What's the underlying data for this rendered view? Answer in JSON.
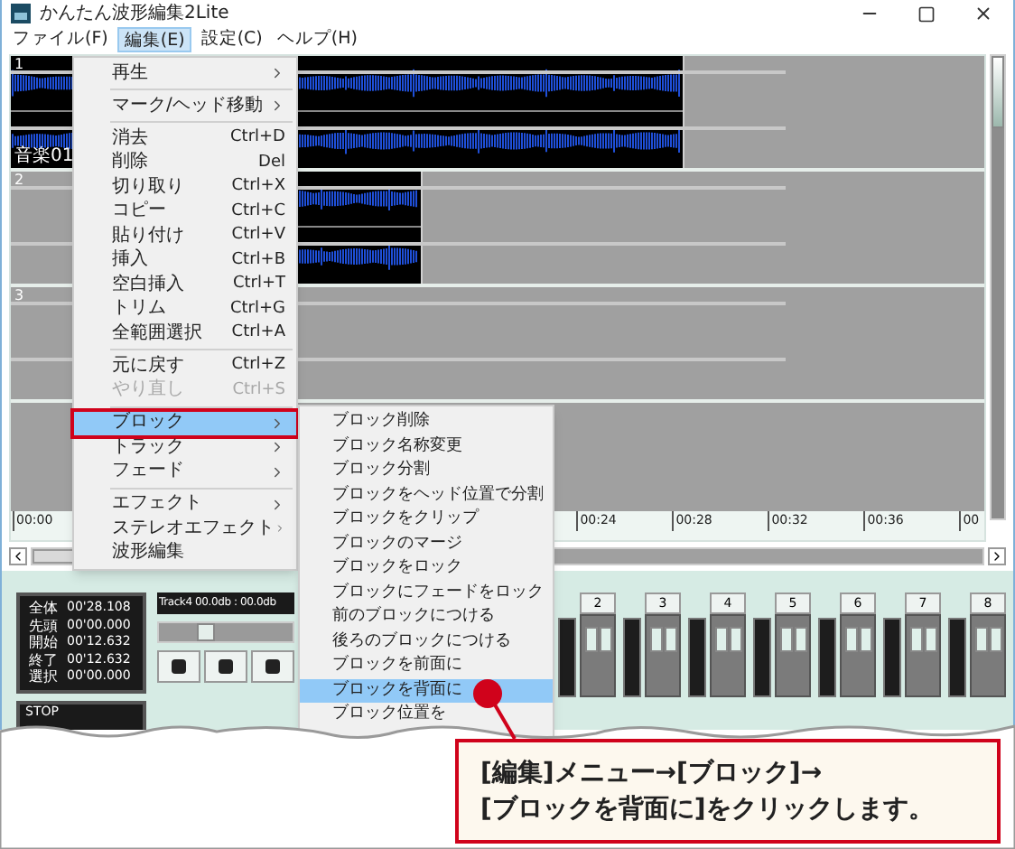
{
  "window": {
    "title": "かんたん波形編集2Lite"
  },
  "menu_bar": [
    {
      "label": "ファイル(F)",
      "selected": false
    },
    {
      "label": "編集(E)",
      "selected": true
    },
    {
      "label": "設定(C)",
      "selected": false
    },
    {
      "label": "ヘルプ(H)",
      "selected": false
    }
  ],
  "tracks": [
    {
      "label": "1",
      "name": "音楽01",
      "kind": "audio"
    },
    {
      "label": "2",
      "kind": "audio"
    },
    {
      "label": "3",
      "kind": "empty"
    }
  ],
  "timeline": {
    "start": "00:00",
    "ticks": [
      "00:24",
      "00:28",
      "00:32",
      "00:36",
      "00"
    ]
  },
  "time_info": [
    {
      "label": "全体",
      "value": "00'28.108"
    },
    {
      "label": "先頭",
      "value": "00'00.000"
    },
    {
      "label": "開始",
      "value": "00'12.632"
    },
    {
      "label": "終了",
      "value": "00'12.632"
    },
    {
      "label": "選択",
      "value": "00'00.000"
    }
  ],
  "transport": {
    "status": "STOP",
    "track_readout": "Track4 00.0db : 00.0db",
    "level": 0.35
  },
  "mixer_channels": [
    "2",
    "3",
    "4",
    "5",
    "6",
    "7",
    "8"
  ],
  "edit_menu": [
    {
      "kind": "item",
      "label": "再生",
      "submenu": true,
      "selected": false,
      "disabled": false
    },
    {
      "kind": "separator"
    },
    {
      "kind": "item",
      "label": "マーク/ヘッド移動",
      "submenu": true,
      "selected": false,
      "disabled": false
    },
    {
      "kind": "separator"
    },
    {
      "kind": "item",
      "label": "消去",
      "shortcut": "Ctrl+D",
      "submenu": false,
      "selected": false,
      "disabled": false
    },
    {
      "kind": "item",
      "label": "削除",
      "shortcut": "Del",
      "submenu": false,
      "selected": false,
      "disabled": false
    },
    {
      "kind": "item",
      "label": "切り取り",
      "shortcut": "Ctrl+X",
      "submenu": false,
      "selected": false,
      "disabled": false
    },
    {
      "kind": "item",
      "label": "コピー",
      "shortcut": "Ctrl+C",
      "submenu": false,
      "selected": false,
      "disabled": false
    },
    {
      "kind": "item",
      "label": "貼り付け",
      "shortcut": "Ctrl+V",
      "submenu": false,
      "selected": false,
      "disabled": false
    },
    {
      "kind": "item",
      "label": "挿入",
      "shortcut": "Ctrl+B",
      "submenu": false,
      "selected": false,
      "disabled": false
    },
    {
      "kind": "item",
      "label": "空白挿入",
      "shortcut": "Ctrl+T",
      "submenu": false,
      "selected": false,
      "disabled": false
    },
    {
      "kind": "item",
      "label": "トリム",
      "shortcut": "Ctrl+G",
      "submenu": false,
      "selected": false,
      "disabled": false
    },
    {
      "kind": "item",
      "label": "全範囲選択",
      "shortcut": "Ctrl+A",
      "submenu": false,
      "selected": false,
      "disabled": false
    },
    {
      "kind": "separator"
    },
    {
      "kind": "item",
      "label": "元に戻す",
      "shortcut": "Ctrl+Z",
      "submenu": false,
      "selected": false,
      "disabled": false
    },
    {
      "kind": "item",
      "label": "やり直し",
      "shortcut": "Ctrl+S",
      "submenu": false,
      "selected": false,
      "disabled": true
    },
    {
      "kind": "separator"
    },
    {
      "kind": "item",
      "label": "ブロック",
      "submenu": true,
      "selected": true,
      "disabled": false
    },
    {
      "kind": "item",
      "label": "トラック",
      "submenu": true,
      "selected": false,
      "disabled": false
    },
    {
      "kind": "item",
      "label": "フェード",
      "submenu": true,
      "selected": false,
      "disabled": false
    },
    {
      "kind": "separator"
    },
    {
      "kind": "item",
      "label": "エフェクト",
      "submenu": true,
      "selected": false,
      "disabled": false
    },
    {
      "kind": "item",
      "label": "ステレオエフェクト",
      "submenu": true,
      "selected": false,
      "disabled": false
    },
    {
      "kind": "item",
      "label": "波形編集",
      "submenu": false,
      "selected": false,
      "disabled": false
    }
  ],
  "block_submenu": [
    {
      "label": "ブロック削除",
      "selected": false
    },
    {
      "label": "ブロック名称変更",
      "selected": false
    },
    {
      "label": "ブロック分割",
      "selected": false
    },
    {
      "label": "ブロックをヘッド位置で分割",
      "selected": false
    },
    {
      "label": "ブロックをクリップ",
      "selected": false
    },
    {
      "label": "ブロックのマージ",
      "selected": false
    },
    {
      "label": "ブロックをロック",
      "selected": false
    },
    {
      "label": "ブロックにフェードをロック",
      "selected": false
    },
    {
      "label": "前のブロックにつける",
      "selected": false
    },
    {
      "label": "後ろのブロックにつける",
      "selected": false
    },
    {
      "label": "ブロックを前面に",
      "selected": false
    },
    {
      "label": "ブロックを背面に",
      "selected": true
    },
    {
      "label": "ブロック位置を",
      "selected": false
    }
  ],
  "callout": {
    "lines": [
      "[編集]メニュー→[ブロック]→",
      "[ブロックを背面に]をクリックします。"
    ]
  }
}
